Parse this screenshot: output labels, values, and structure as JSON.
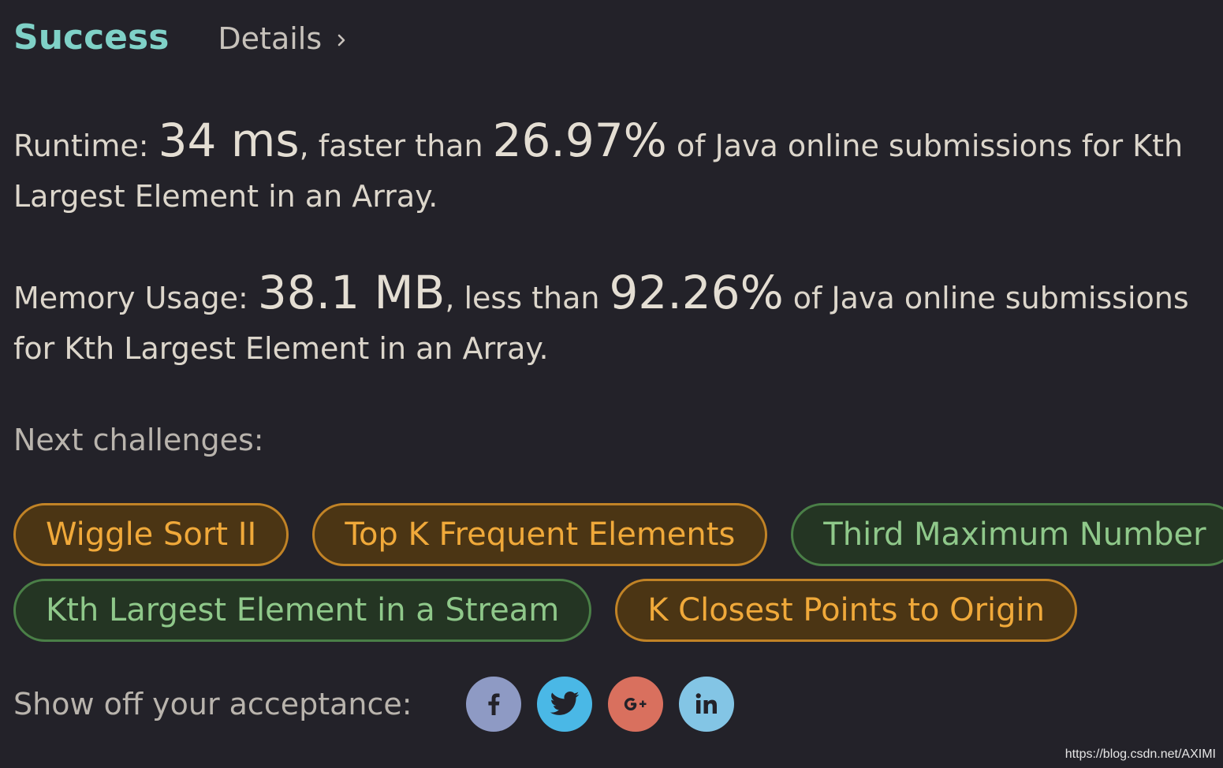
{
  "header": {
    "status": "Success",
    "details_label": "Details"
  },
  "runtime": {
    "label": "Runtime: ",
    "value": "34 ms",
    "mid": ", faster than ",
    "percent": "26.97%",
    "tail": " of Java online submissions for Kth Largest Element in an Array."
  },
  "memory": {
    "label": "Memory Usage: ",
    "value": "38.1 MB",
    "mid": ", less than ",
    "percent": "92.26%",
    "tail": " of Java online submissions for Kth Largest Element in an Array."
  },
  "next": {
    "title": "Next challenges:",
    "challenges": [
      {
        "label": "Wiggle Sort II",
        "difficulty": "medium"
      },
      {
        "label": "Top K Frequent Elements",
        "difficulty": "medium"
      },
      {
        "label": "Third Maximum Number",
        "difficulty": "easy"
      },
      {
        "label": "Kth Largest Element in a Stream",
        "difficulty": "easy"
      },
      {
        "label": "K Closest Points to Origin",
        "difficulty": "medium"
      }
    ]
  },
  "share": {
    "label": "Show off your acceptance:",
    "buttons": [
      {
        "icon": "facebook-icon",
        "color": "#8e9ac4"
      },
      {
        "icon": "twitter-icon",
        "color": "#4ab8e6"
      },
      {
        "icon": "google-plus-icon",
        "color": "#d9705e"
      },
      {
        "icon": "linkedin-icon",
        "color": "#83c5e5"
      }
    ]
  },
  "colors": {
    "background": "#232229",
    "success": "#7fd1c7",
    "medium_text": "#f0a93a",
    "easy_text": "#8fc88a"
  },
  "watermark": "https://blog.csdn.net/AXIMI"
}
